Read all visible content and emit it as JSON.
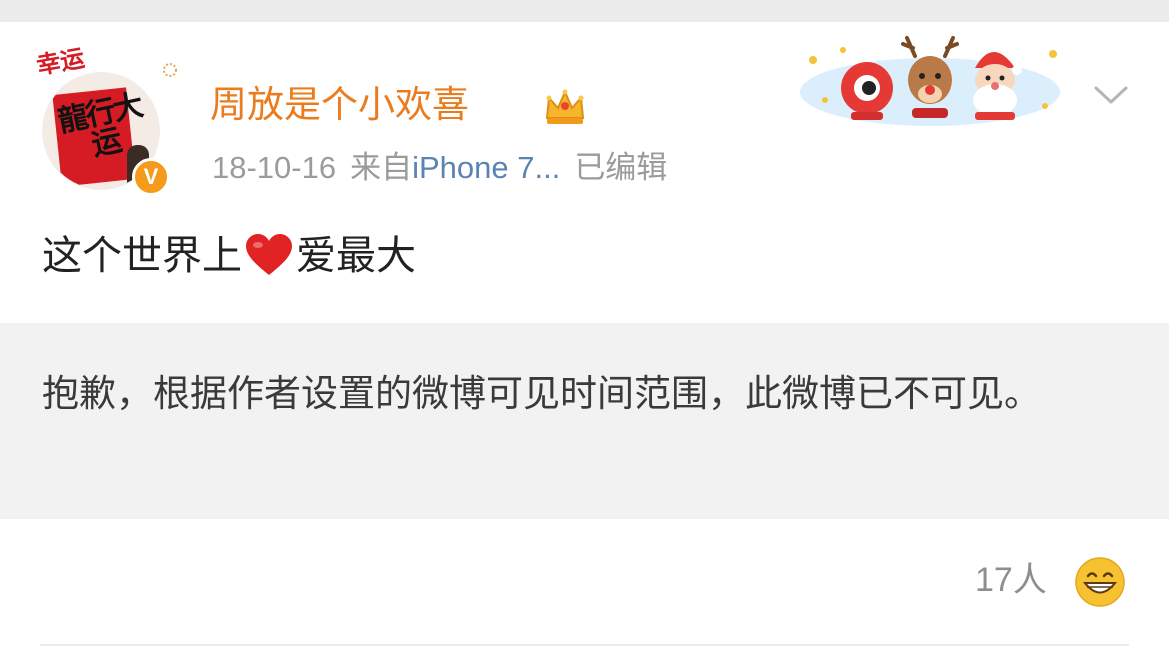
{
  "post": {
    "avatar": {
      "overlay_text_top": "幸运",
      "overlay_text_main": "龍行大运",
      "verified_badge": "V"
    },
    "username": "周放是个小欢喜",
    "meta": {
      "date": "18-10-16",
      "source_prefix": "来自",
      "source_device": "iPhone 7...",
      "edited": "已编辑"
    },
    "content": {
      "text_before": "这个世界上",
      "emoji": "red-heart",
      "text_after": "爱最大"
    },
    "notice": "抱歉，根据作者设置的微博可见时间范围，此微博已不可见。",
    "likes": {
      "count": "17人",
      "emoji": "grinning-face"
    }
  },
  "icons": {
    "crown": "crown-icon",
    "more": "chevron-down-icon",
    "decoration": "christmas-characters"
  },
  "colors": {
    "username": "#ea7c1e",
    "source_link": "#5b84b1",
    "meta_gray": "#9b9b9b",
    "notice_bg": "#f2f2f2",
    "heart": "#e02424",
    "verified": "#f59a1a"
  }
}
